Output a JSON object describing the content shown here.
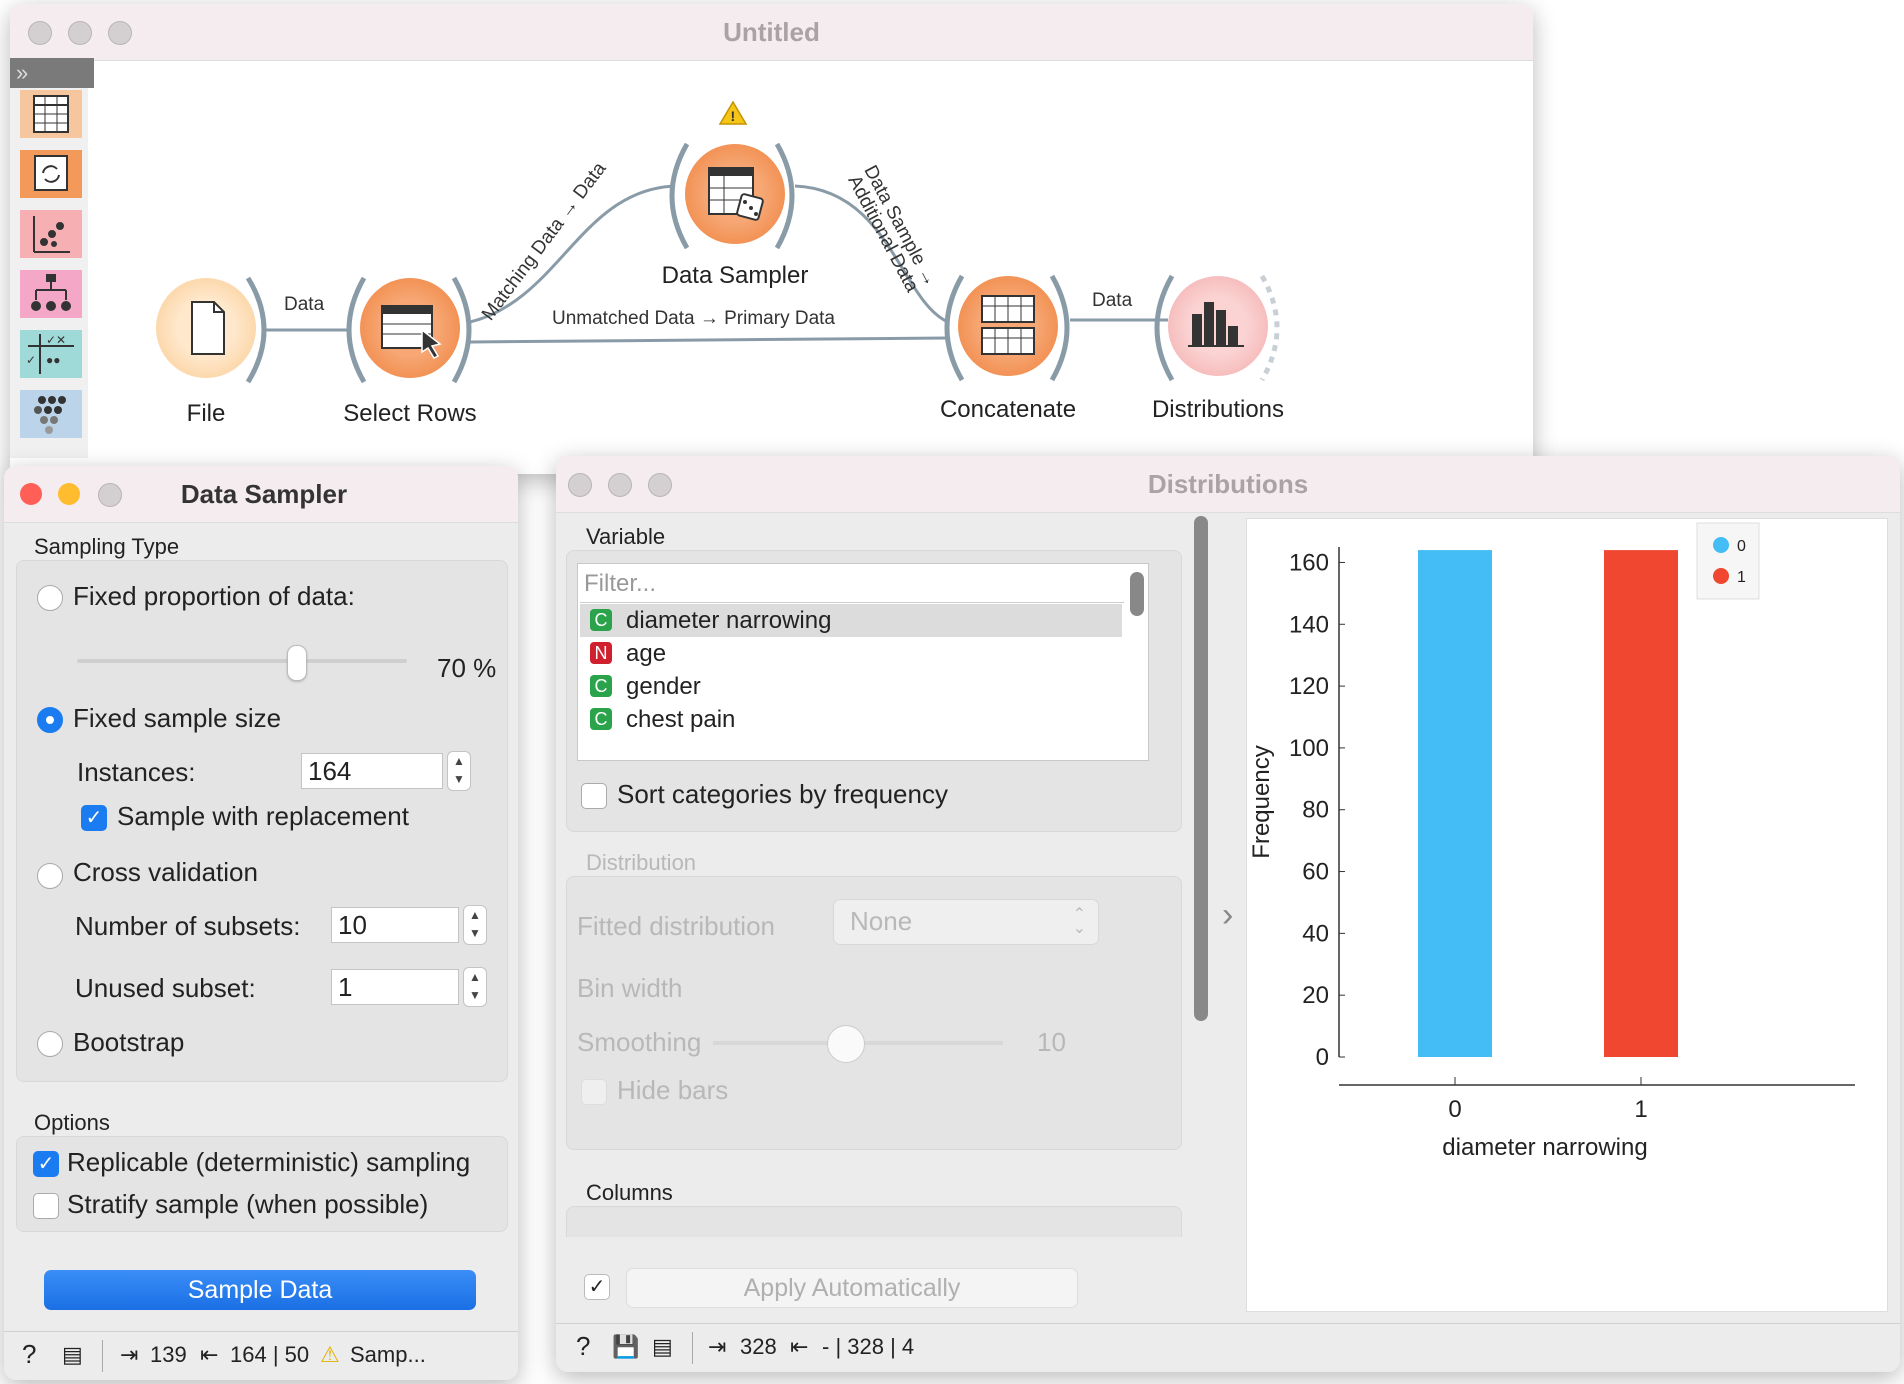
{
  "canvas": {
    "title": "Untitled",
    "nodes": {
      "file": "File",
      "select_rows": "Select Rows",
      "data_sampler": "Data Sampler",
      "concatenate": "Concatenate",
      "distributions": "Distributions"
    },
    "edges": {
      "file_select": "Data",
      "select_sampler": "Matching Data → Data",
      "select_concat": "Unmatched Data → Primary Data",
      "sampler_concat_1": "Data Sample →",
      "sampler_concat_2": "Additional Data",
      "concat_dist": "Data"
    }
  },
  "data_sampler": {
    "title": "Data Sampler",
    "sampling_type_label": "Sampling Type",
    "fixed_proportion_label": "Fixed proportion of data:",
    "proportion_value": "70 %",
    "proportion_fraction": 0.7,
    "fixed_size_label": "Fixed sample size",
    "instances_label": "Instances:",
    "instances_value": "164",
    "replacement_label": "Sample with replacement",
    "cross_validation_label": "Cross validation",
    "subsets_label": "Number of subsets:",
    "subsets_value": "10",
    "unused_label": "Unused subset:",
    "unused_value": "1",
    "bootstrap_label": "Bootstrap",
    "options_label": "Options",
    "replicable_label": "Replicable (deterministic) sampling",
    "stratify_label": "Stratify sample (when possible)",
    "sample_button": "Sample Data",
    "status": {
      "input_count": "139",
      "output_count": "164 | 50",
      "warning_text": "Samp..."
    }
  },
  "distributions": {
    "title": "Distributions",
    "variable_label": "Variable",
    "filter_placeholder": "Filter...",
    "variables": [
      {
        "badge": "C",
        "name": "diameter narrowing",
        "color": "#2aa34a"
      },
      {
        "badge": "N",
        "name": "age",
        "color": "#d0202e"
      },
      {
        "badge": "C",
        "name": "gender",
        "color": "#2aa34a"
      },
      {
        "badge": "C",
        "name": "chest pain",
        "color": "#2aa34a"
      }
    ],
    "sort_label": "Sort categories by frequency",
    "distribution_label": "Distribution",
    "fitted_label": "Fitted distribution",
    "fitted_value": "None",
    "bin_width_label": "Bin width",
    "smoothing_label": "Smoothing",
    "smoothing_value": "10",
    "hide_bars_label": "Hide bars",
    "columns_label": "Columns",
    "apply_label": "Apply Automatically",
    "status": {
      "input_count": "328",
      "output_text": "- | 328 | 4"
    }
  },
  "chart_data": {
    "type": "bar",
    "categories": [
      "0",
      "1"
    ],
    "values": [
      164,
      164
    ],
    "colors": [
      "#44bcf5",
      "#ef4730"
    ],
    "xlabel": "diameter narrowing",
    "ylabel": "Frequency",
    "ylim": [
      0,
      165
    ],
    "yticks": [
      "0",
      "20",
      "40",
      "60",
      "80",
      "100",
      "120",
      "140",
      "160"
    ],
    "legend": [
      "0",
      "1"
    ],
    "legend_position": "top-right"
  }
}
